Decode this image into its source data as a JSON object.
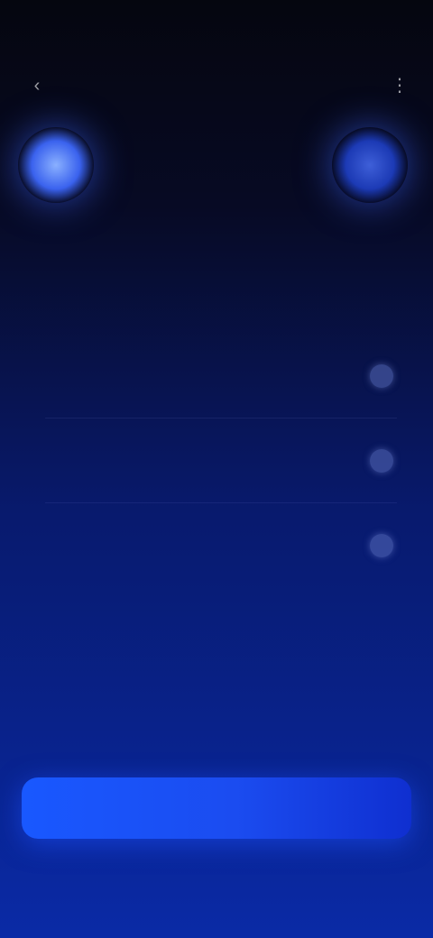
{
  "status_bar": {
    "time": "",
    "icons": ""
  },
  "nav": {
    "back_icon": "chevron-left-icon",
    "more_icon": "more-icon"
  },
  "hero": {
    "caption": ""
  },
  "title": "",
  "subtitle": "",
  "options": [
    {
      "label": "",
      "selected": false
    },
    {
      "label": "",
      "selected": false
    },
    {
      "label": "",
      "selected": false
    }
  ],
  "note": "",
  "primary_button": {
    "label": ""
  },
  "colors": {
    "accent": "#1958ff",
    "background_top": "#05060f",
    "background_bottom": "#0a2aa6"
  }
}
